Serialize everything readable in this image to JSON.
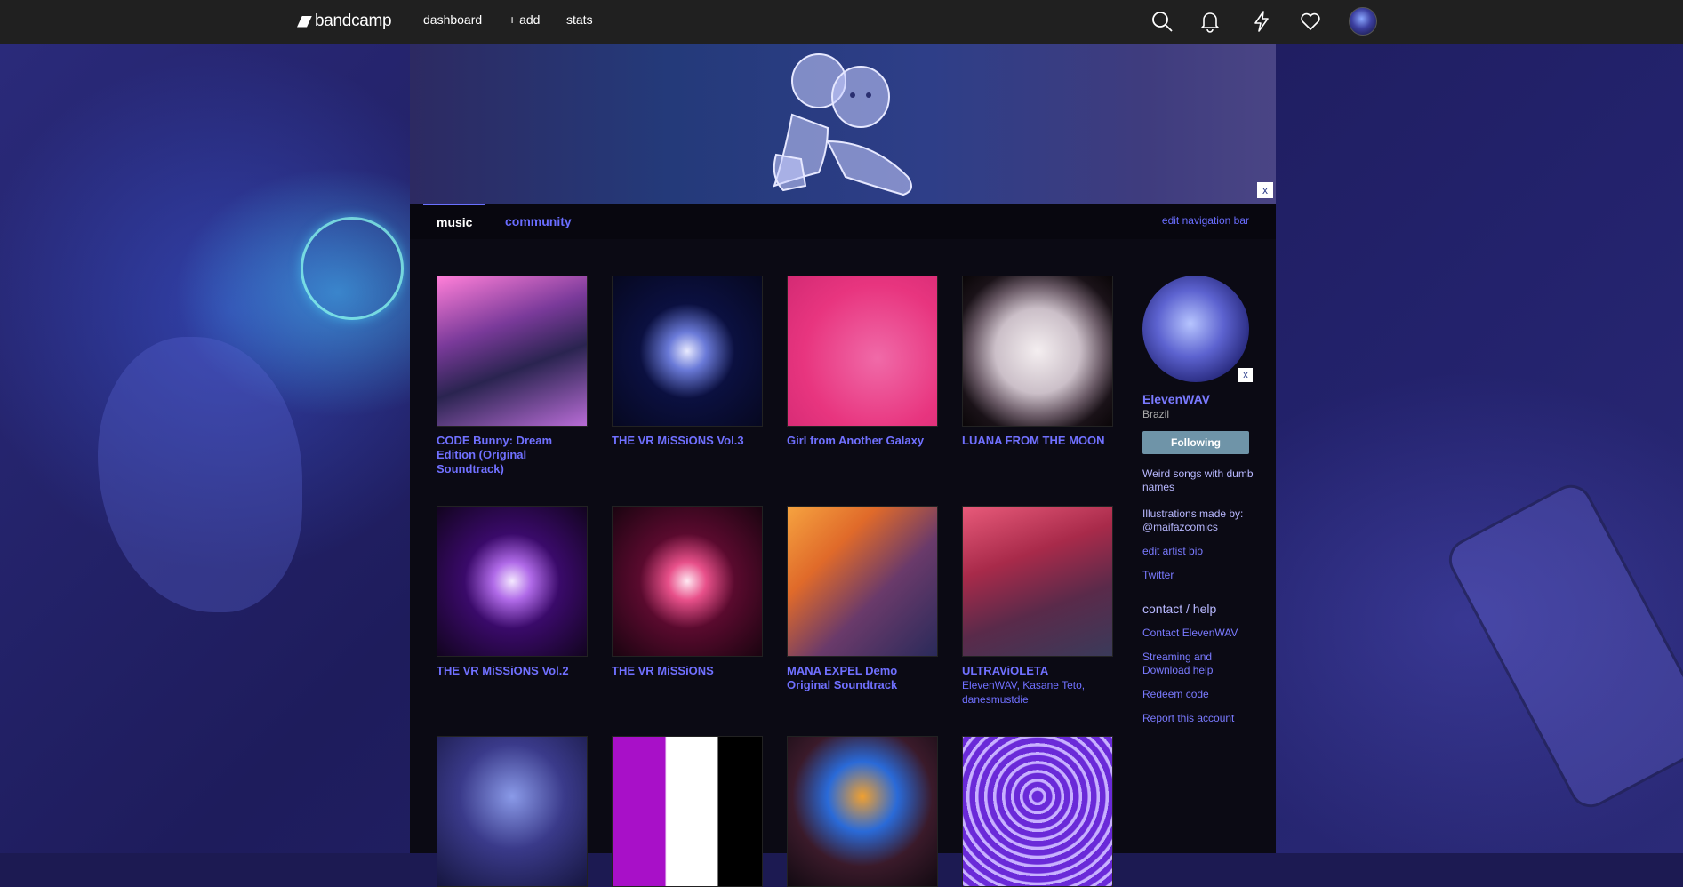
{
  "nav": {
    "logo": "bandcamp",
    "links": [
      "dashboard",
      "+ add",
      "stats"
    ]
  },
  "icons": [
    "search-icon",
    "bell-icon",
    "lightning-icon",
    "heart-icon"
  ],
  "banner": {
    "close": "x"
  },
  "tabs": {
    "music": "music",
    "community": "community",
    "edit": "edit navigation bar"
  },
  "albums": [
    {
      "title": "CODE Bunny: Dream Edition (Original Soundtrack)",
      "artist": ""
    },
    {
      "title": "THE VR MiSSiONS Vol.3",
      "artist": ""
    },
    {
      "title": "Girl from Another Galaxy",
      "artist": ""
    },
    {
      "title": "LUANA FROM THE MOON",
      "artist": ""
    },
    {
      "title": "THE VR MiSSiONS Vol.2",
      "artist": ""
    },
    {
      "title": "THE VR MiSSiONS",
      "artist": ""
    },
    {
      "title": "MANA EXPEL Demo Original Soundtrack",
      "artist": ""
    },
    {
      "title": "ULTRAViOLETA",
      "artist": "ElevenWAV, Kasane Teto, danesmustdie"
    }
  ],
  "sidebar": {
    "close": "x",
    "name": "ElevenWAV",
    "location": "Brazil",
    "follow": "Following",
    "bio1": "Weird songs with dumb names",
    "bio2": "Illustrations made by: @maifazcomics",
    "edit_bio": "edit artist bio",
    "twitter": "Twitter",
    "contact_heading": "contact / help",
    "contact": "Contact ElevenWAV",
    "streaming": "Streaming and Download help",
    "redeem": "Redeem code",
    "report": "Report this account"
  }
}
